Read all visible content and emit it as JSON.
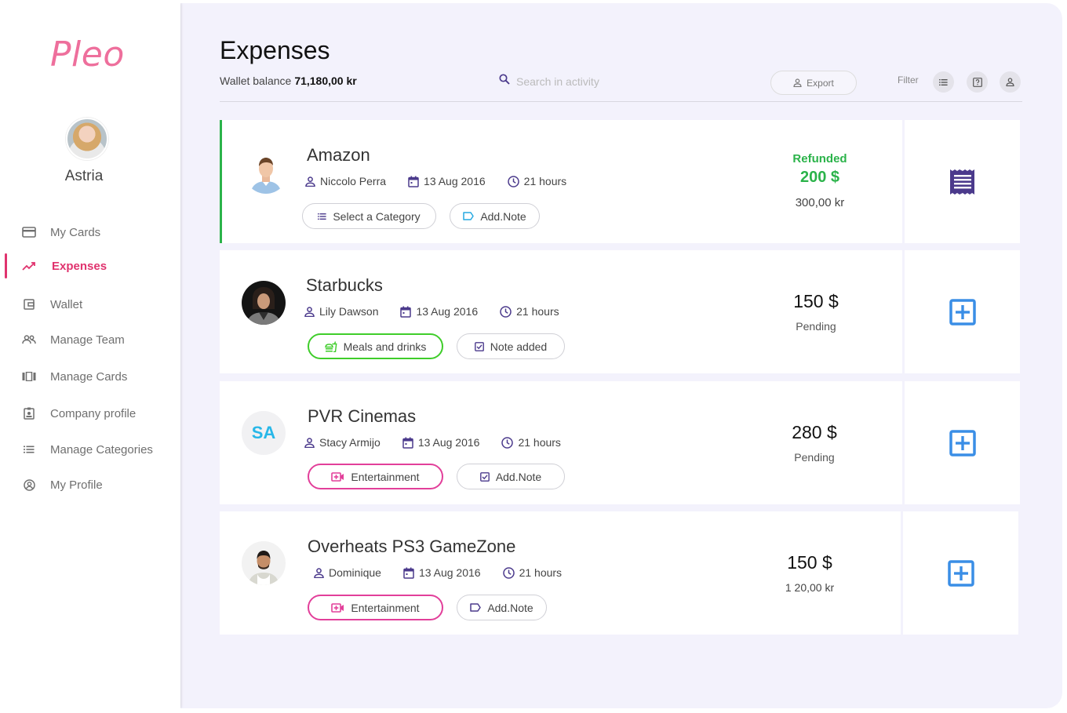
{
  "app": {
    "logo": "Pleo"
  },
  "profile": {
    "name": "Astria"
  },
  "nav": [
    {
      "label": "My Cards",
      "icon": "credit-card-icon",
      "active": false
    },
    {
      "label": "Expenses",
      "icon": "trending-up-icon",
      "active": true
    },
    {
      "label": "Wallet",
      "icon": "wallet-icon",
      "active": false
    },
    {
      "label": "Manage Team",
      "icon": "people-icon",
      "active": false
    },
    {
      "label": "Manage Cards",
      "icon": "cards-icon",
      "active": false
    },
    {
      "label": "Company profile",
      "icon": "badge-icon",
      "active": false
    },
    {
      "label": "Manage Categories",
      "icon": "list-icon",
      "active": false
    },
    {
      "label": "My Profile",
      "icon": "account-circle-icon",
      "active": false
    }
  ],
  "header": {
    "title": "Expenses",
    "wallet_label": "Wallet balance",
    "wallet_value": "71,180,00 kr",
    "search_placeholder": "Search in activity",
    "export_label": "Export",
    "filter_label": "Filter"
  },
  "expenses": [
    {
      "merchant": "Amazon",
      "person": "Niccolo Perra",
      "date": "13 Aug 2016",
      "time": "21 hours",
      "category": "Select a Category",
      "note": "Add.Note",
      "status": "Refunded",
      "amount": "200 $",
      "converted": "300,00 kr",
      "action_icon": "receipt-icon"
    },
    {
      "merchant": "Starbucks",
      "person": "Lily Dawson",
      "date": "13 Aug 2016",
      "time": "21 hours",
      "category": "Meals and drinks",
      "note": "Note added",
      "amount": "150 $",
      "status": "Pending",
      "action_icon": "add-box-icon"
    },
    {
      "merchant": "PVR Cinemas",
      "initials": "SA",
      "person": "Stacy Armijo",
      "date": "13 Aug 2016",
      "time": "21 hours",
      "category": "Entertainment",
      "note": "Add.Note",
      "amount": "280 $",
      "status": "Pending",
      "action_icon": "add-box-icon"
    },
    {
      "merchant": "Overheats PS3 GameZone",
      "person": "Dominique",
      "date": "13 Aug 2016",
      "time": "21 hours",
      "category": "Entertainment",
      "note": "Add.Note",
      "amount": "150 $",
      "converted": "1 20,00 kr",
      "action_icon": "add-box-icon"
    }
  ],
  "colors": {
    "accent": "#e0336e",
    "refunded": "#2bb34a",
    "meals": "#3fcd2a",
    "entertainment": "#e23f9a",
    "add": "#3a8ee6",
    "receipt": "#4b3a8c"
  }
}
